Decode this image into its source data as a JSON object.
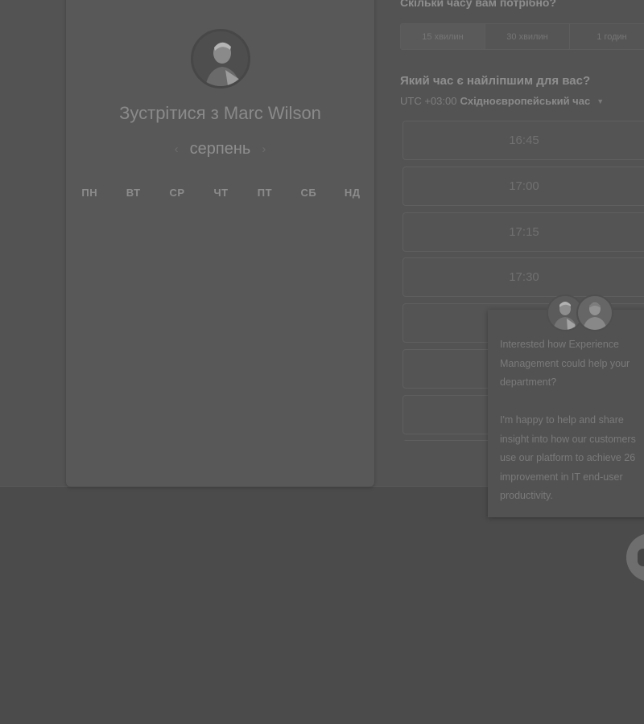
{
  "scheduler": {
    "host_avatar_icon": "person-avatar",
    "meet_title": "Зустрітися з Marc Wilson",
    "month": "серпень",
    "prev_month_icon": "chevron-left-icon",
    "next_month_icon": "chevron-right-icon",
    "weekdays": [
      "ПН",
      "ВТ",
      "СР",
      "ЧТ",
      "ПТ",
      "СБ",
      "НД"
    ]
  },
  "duration": {
    "question": "Скільки часу вам потрібно?",
    "options": [
      "15 хвилин",
      "30 хвилин",
      "1 годин"
    ],
    "selected_index": 0
  },
  "time": {
    "question": "Який час є найліпшим для вас?",
    "tz_offset": "UTC +03:00",
    "tz_name": "Східноєвропейський час",
    "tz_dropdown_icon": "caret-down-icon",
    "slots": [
      "16:45",
      "17:00",
      "17:15",
      "17:30",
      "",
      "",
      "",
      ""
    ]
  },
  "chat": {
    "avatar_icons": [
      "agent-avatar",
      "agent-avatar"
    ],
    "message": "Interested how Experience Management could help your department?\n\nI'm happy to help and share insight into how our customers use our platform to achieve 26 improvement in IT end-user productivity.",
    "launcher_icon": "chat-bubble-icon"
  },
  "colors": {
    "backdrop": "#4b4b4b",
    "card": "#585858"
  }
}
